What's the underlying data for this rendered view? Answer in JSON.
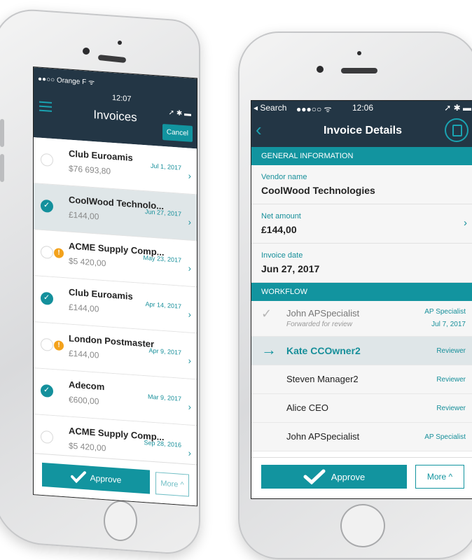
{
  "left": {
    "status": {
      "carrier": "●●○○ Orange F ᯤ",
      "time": "12:07",
      "icons": "➚ ✱ ▬"
    },
    "title": "Invoices",
    "cancel_label": "Cancel",
    "rows": [
      {
        "name": "Club Euroamis",
        "amount": "$76 693,80",
        "date": "Jul 1, 2017",
        "checked": false,
        "warning": false
      },
      {
        "name": "CoolWood Technolo...",
        "amount": "£144,00",
        "date": "Jun 27, 2017",
        "checked": true,
        "warning": false
      },
      {
        "name": "ACME Supply Comp...",
        "amount": "$5 420,00",
        "date": "May 23, 2017",
        "checked": false,
        "warning": true
      },
      {
        "name": "Club Euroamis",
        "amount": "£144,00",
        "date": "Apr 14, 2017",
        "checked": true,
        "warning": false
      },
      {
        "name": "London Postmaster",
        "amount": "£144,00",
        "date": "Apr 9, 2017",
        "checked": false,
        "warning": true
      },
      {
        "name": "Adecom",
        "amount": "€600,00",
        "date": "Mar 9, 2017",
        "checked": true,
        "warning": false
      },
      {
        "name": "ACME Supply Comp...",
        "amount": "$5 420,00",
        "date": "Sep 28, 2016",
        "checked": false,
        "warning": false
      }
    ],
    "approve_label": "Approve",
    "more_label": "More"
  },
  "right": {
    "status": {
      "back_app": "◂ Search",
      "signal": "●●●○○ ᯤ",
      "time": "12:06",
      "icons": "➚ ✱ ▬"
    },
    "title": "Invoice Details",
    "general_header": "GENERAL INFORMATION",
    "fields": [
      {
        "label": "Vendor name",
        "value": "CoolWood Technologies"
      },
      {
        "label": "Net amount",
        "value": "£144,00"
      },
      {
        "label": "Invoice date",
        "value": "Jun 27, 2017"
      }
    ],
    "workflow_header": "WORKFLOW",
    "workflow": [
      {
        "name": "John APSpecialist",
        "sub": "Forwarded for review",
        "role": "AP Specialist",
        "date": "Jul 7, 2017"
      },
      {
        "name": "Kate CCOwner2",
        "role": "Reviewer"
      },
      {
        "name": "Steven Manager2",
        "role": "Reviewer"
      },
      {
        "name": "Alice CEO",
        "role": "Reviewer"
      },
      {
        "name": "John APSpecialist",
        "role": "AP Specialist"
      }
    ],
    "approve_label": "Approve",
    "more_label": "More"
  },
  "colors": {
    "header": "#233645",
    "accent": "#12949f",
    "selected_row": "#dfe6e8",
    "warning": "#f3a21c"
  }
}
